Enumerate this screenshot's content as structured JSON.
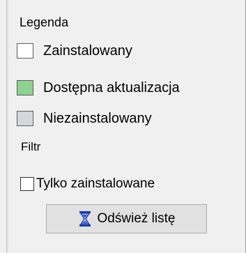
{
  "legend": {
    "title": "Legenda",
    "items": [
      {
        "label": "Zainstalowany",
        "color": "#ffffff"
      },
      {
        "label": "Dostępna aktualizacja",
        "color": "#8fd28f"
      },
      {
        "label": "Niezainstalowany",
        "color": "#d4d7dc"
      }
    ]
  },
  "filter": {
    "title": "Filtr",
    "checkbox_label": "Tylko zainstalowane",
    "checkbox_checked": false
  },
  "refresh_button": {
    "label": "Odśwież listę",
    "icon": "hourglass-icon"
  }
}
